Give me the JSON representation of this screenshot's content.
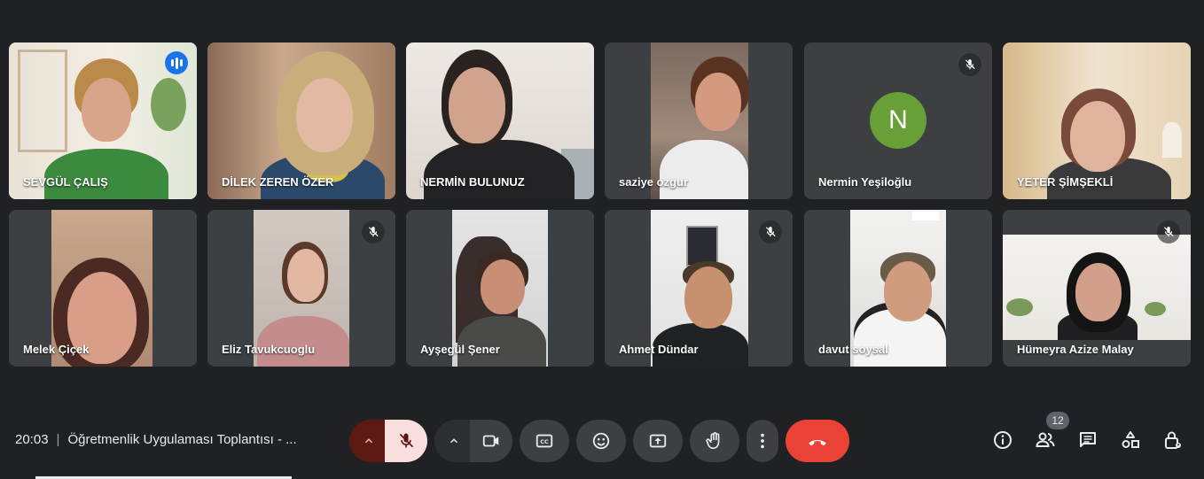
{
  "participants": [
    {
      "name": "SEVGÜL ÇALIŞ"
    },
    {
      "name": "DİLEK ZEREN ÖZER"
    },
    {
      "name": "NERMİN BULUNUZ"
    },
    {
      "name": "saziye ozgur"
    },
    {
      "name": "Nermin Yeşiloğlu",
      "avatar_letter": "N"
    },
    {
      "name": "YETER ŞİMŞEKLİ"
    },
    {
      "name": "Melek Çiçek"
    },
    {
      "name": "Eliz Tavukcuoglu"
    },
    {
      "name": "Ayşegül Şener"
    },
    {
      "name": "Ahmet Dündar"
    },
    {
      "name": "davut soysal"
    },
    {
      "name": "Hümeyra Azize Malay"
    }
  ],
  "meeting": {
    "time": "20:03",
    "separator": "|",
    "title": "Öğretmenlik Uygulaması Toplantısı - ..."
  },
  "participant_count": "12",
  "colors": {
    "background": "#202124",
    "tile": "#3c4043",
    "mic_off_active": "#f9dedc",
    "mic_menu": "#5c1a12",
    "end_call": "#ea4335",
    "speaking": "#1a73e8",
    "avatar": "#689f38"
  }
}
